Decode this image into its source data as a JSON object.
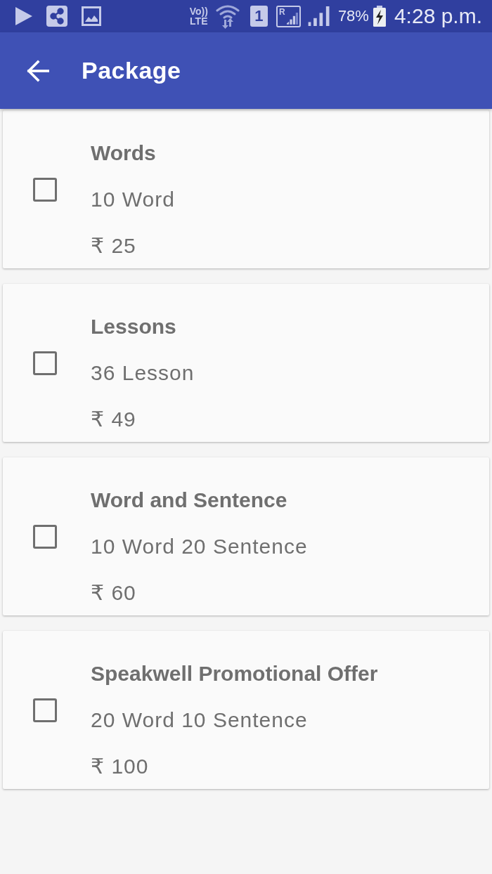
{
  "status_bar": {
    "volte_top": "Vo))",
    "volte_bottom": "LTE",
    "sim_slot": "1",
    "roaming": "R",
    "battery": "78%",
    "time": "4:28 p.m."
  },
  "app_bar": {
    "title": "Package"
  },
  "packages": [
    {
      "name": "Words",
      "details": "10 Word",
      "price": "₹ 25",
      "checked": false
    },
    {
      "name": "Lessons",
      "details": "36 Lesson",
      "price": "₹ 49",
      "checked": false
    },
    {
      "name": "Word and Sentence",
      "details": "10 Word 20 Sentence",
      "price": "₹ 60",
      "checked": false
    },
    {
      "name": "Speakwell Promotional Offer",
      "details": "20 Word 10 Sentence",
      "price": "₹ 100",
      "checked": false
    }
  ]
}
